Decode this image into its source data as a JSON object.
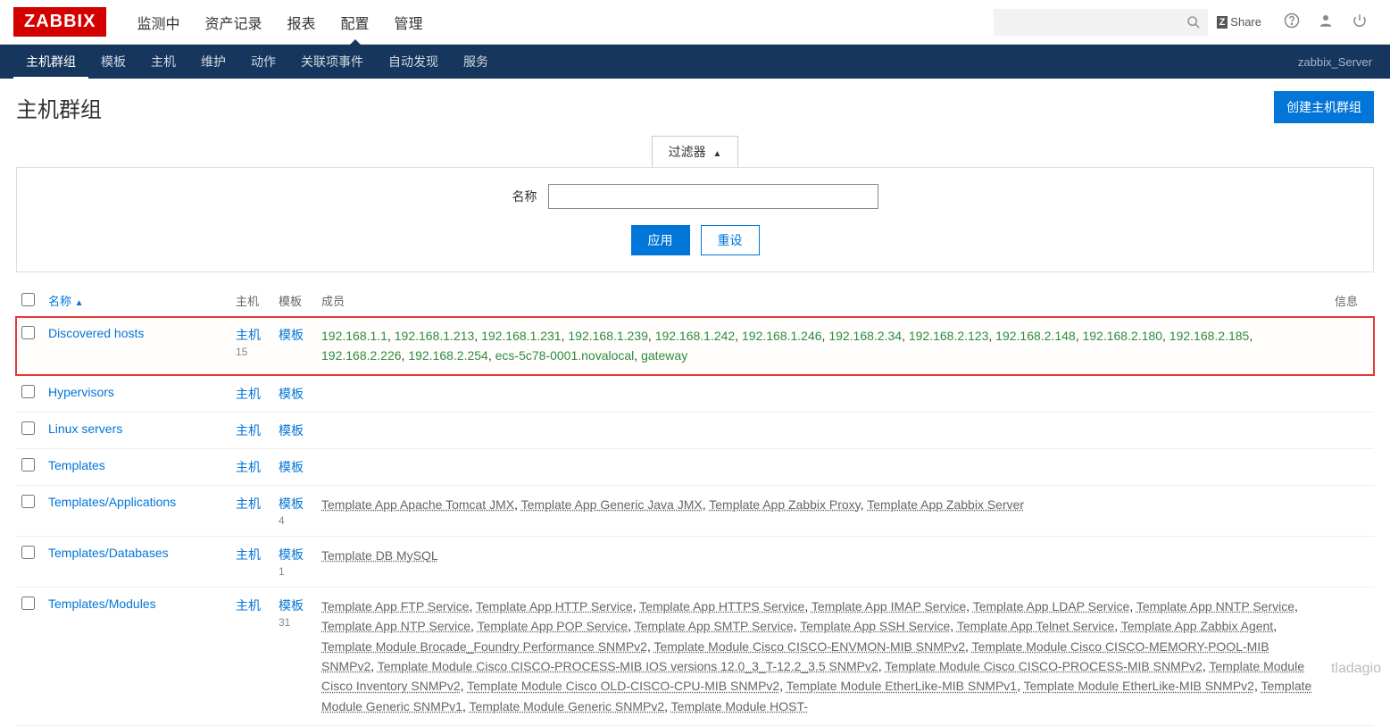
{
  "brand": "ZABBIX",
  "topnav": [
    "监测中",
    "资产记录",
    "报表",
    "配置",
    "管理"
  ],
  "topnav_active": 3,
  "share": "Share",
  "subnav": [
    "主机群组",
    "模板",
    "主机",
    "维护",
    "动作",
    "关联项事件",
    "自动发现",
    "服务"
  ],
  "subnav_active": 0,
  "server_name": "zabbix_Server",
  "page_title": "主机群组",
  "create_btn": "创建主机群组",
  "filter": {
    "tab": "过滤器",
    "name_label": "名称",
    "apply": "应用",
    "reset": "重设"
  },
  "cols": {
    "name": "名称",
    "hosts": "主机",
    "templates": "模板",
    "members": "成员",
    "info": "信息"
  },
  "host_link": "主机",
  "tpl_link": "模板",
  "rows": [
    {
      "name": "Discovered hosts",
      "host_count": "15",
      "tpl_count": "",
      "member_type": "green",
      "members": [
        "192.168.1.1",
        "192.168.1.213",
        "192.168.1.231",
        "192.168.1.239",
        "192.168.1.242",
        "192.168.1.246",
        "192.168.2.34",
        "192.168.2.123",
        "192.168.2.148",
        "192.168.2.180",
        "192.168.2.185",
        "192.168.2.226",
        "192.168.2.254",
        "ecs-5c78-0001.novalocal",
        "gateway"
      ],
      "highlight": true
    },
    {
      "name": "Hypervisors",
      "member_type": "none",
      "members": []
    },
    {
      "name": "Linux servers",
      "member_type": "none",
      "members": []
    },
    {
      "name": "Templates",
      "member_type": "none",
      "members": []
    },
    {
      "name": "Templates/Applications",
      "tpl_count": "4",
      "member_type": "gray",
      "members": [
        "Template App Apache Tomcat JMX",
        "Template App Generic Java JMX",
        "Template App Zabbix Proxy",
        "Template App Zabbix Server"
      ]
    },
    {
      "name": "Templates/Databases",
      "tpl_count": "1",
      "member_type": "gray",
      "members": [
        "Template DB MySQL"
      ]
    },
    {
      "name": "Templates/Modules",
      "tpl_count": "31",
      "member_type": "gray",
      "members": [
        "Template App FTP Service",
        "Template App HTTP Service",
        "Template App HTTPS Service",
        "Template App IMAP Service",
        "Template App LDAP Service",
        "Template App NNTP Service",
        "Template App NTP Service",
        "Template App POP Service",
        "Template App SMTP Service",
        "Template App SSH Service",
        "Template App Telnet Service",
        "Template App Zabbix Agent",
        "Template Module Brocade_Foundry Performance SNMPv2",
        "Template Module Cisco CISCO-ENVMON-MIB SNMPv2",
        "Template Module Cisco CISCO-MEMORY-POOL-MIB SNMPv2",
        "Template Module Cisco CISCO-PROCESS-MIB IOS versions 12.0_3_T-12.2_3.5 SNMPv2",
        "Template Module Cisco CISCO-PROCESS-MIB SNMPv2",
        "Template Module Cisco Inventory SNMPv2",
        "Template Module Cisco OLD-CISCO-CPU-MIB SNMPv2",
        "Template Module EtherLike-MIB SNMPv1",
        "Template Module EtherLike-MIB SNMPv2",
        "Template Module Generic SNMPv1",
        "Template Module Generic SNMPv2",
        "Template Module HOST-"
      ]
    }
  ],
  "watermark": "tladagio"
}
